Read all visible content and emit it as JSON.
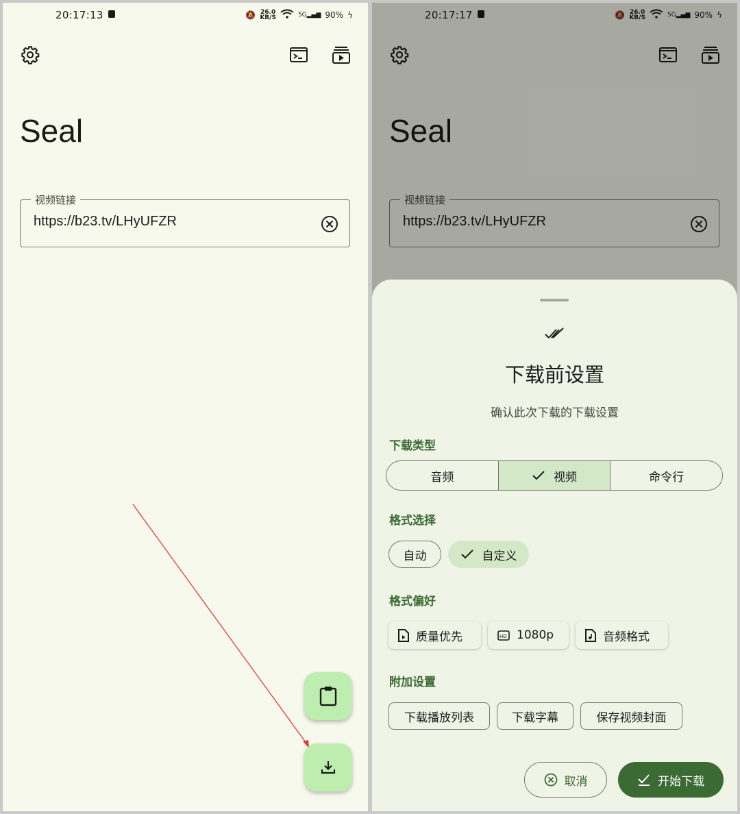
{
  "left_screen": {
    "status": {
      "time": "20:17:13",
      "net_speed": "26.0",
      "net_unit": "KB/S",
      "network": "5G",
      "battery": "90%"
    },
    "app_title": "Seal",
    "url_field": {
      "label": "视频链接",
      "value": "https://b23.tv/LHyUFZR"
    }
  },
  "right_screen": {
    "status": {
      "time": "20:17:17",
      "net_speed": "26.0",
      "net_unit": "KB/S",
      "network": "5G",
      "battery": "90%"
    },
    "app_title": "Seal",
    "url_field": {
      "label": "视频链接",
      "value": "https://b23.tv/LHyUFZR"
    },
    "sheet": {
      "title": "下载前设置",
      "subtitle": "确认此次下载的下载设置",
      "download_type": {
        "label": "下载类型",
        "options": [
          "音频",
          "视频",
          "命令行"
        ],
        "selected": "视频"
      },
      "format_select": {
        "label": "格式选择",
        "options": [
          "自动",
          "自定义"
        ],
        "selected": "自定义"
      },
      "format_pref": {
        "label": "格式偏好",
        "items": [
          "质量优先",
          "1080p",
          "音频格式"
        ]
      },
      "extra": {
        "label": "附加设置",
        "items": [
          "下载播放列表",
          "下载字幕",
          "保存视频封面"
        ]
      },
      "cancel": "取消",
      "start": "开始下载"
    }
  },
  "colors": {
    "background": "#f7f9ec",
    "accent": "#3b6a33",
    "chip_selected": "#d3e8c7",
    "fab": "#bdeeb0",
    "arrow": "#e53935"
  }
}
